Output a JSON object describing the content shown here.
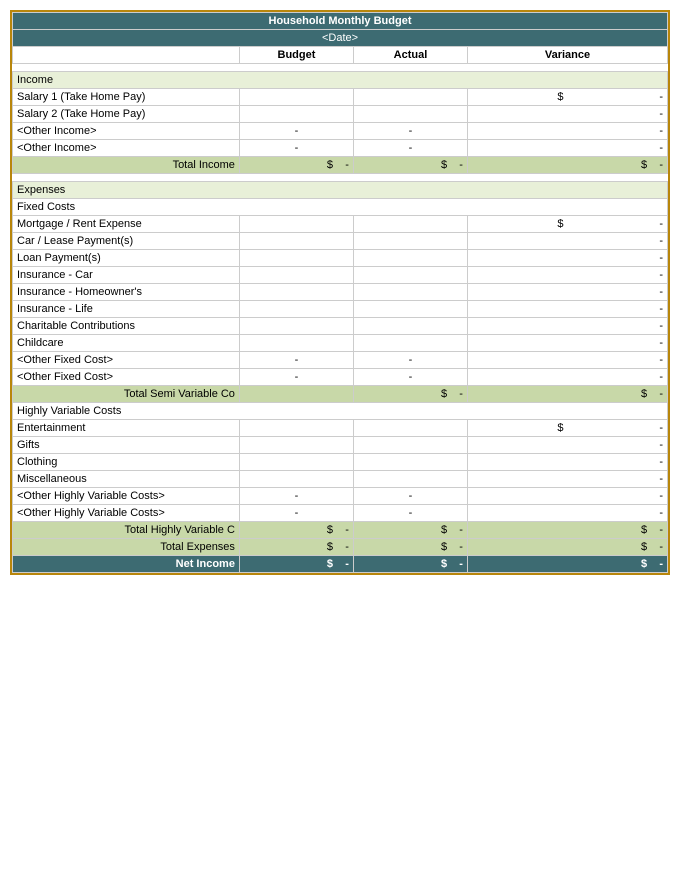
{
  "header": {
    "title": "Household Monthly Budget",
    "date": "<Date>",
    "col_budget": "Budget",
    "col_actual": "Actual",
    "col_variance": "Variance"
  },
  "income": {
    "section_label": "Income",
    "rows": [
      {
        "label": "Salary 1 (Take Home Pay)",
        "budget": "",
        "actual": "",
        "variance_dollar": "$",
        "variance": "-"
      },
      {
        "label": "Salary 2 (Take Home Pay)",
        "budget": "",
        "actual": "",
        "variance_dollar": "",
        "variance": "-"
      },
      {
        "label": "<Other Income>",
        "budget": "-",
        "actual": "-",
        "variance_dollar": "",
        "variance": "-"
      },
      {
        "label": "<Other Income>",
        "budget": "-",
        "actual": "-",
        "variance_dollar": "",
        "variance": "-"
      }
    ],
    "total_label": "Total Income",
    "total_budget_dollar": "$",
    "total_budget": "-",
    "total_actual_dollar": "$",
    "total_actual": "-",
    "total_variance_dollar": "$",
    "total_variance": "-"
  },
  "expenses": {
    "section_label": "Expenses",
    "fixed_costs_label": "Fixed Costs",
    "fixed_rows": [
      {
        "label": "Mortgage / Rent Expense",
        "budget": "",
        "actual": "",
        "variance_dollar": "$",
        "variance": "-"
      },
      {
        "label": "Car / Lease Payment(s)",
        "budget": "",
        "actual": "",
        "variance_dollar": "",
        "variance": "-"
      },
      {
        "label": "Loan Payment(s)",
        "budget": "",
        "actual": "",
        "variance_dollar": "",
        "variance": "-"
      },
      {
        "label": "Insurance - Car",
        "budget": "",
        "actual": "",
        "variance_dollar": "",
        "variance": "-"
      },
      {
        "label": "Insurance - Homeowner's",
        "budget": "",
        "actual": "",
        "variance_dollar": "",
        "variance": "-"
      },
      {
        "label": "Insurance - Life",
        "budget": "",
        "actual": "",
        "variance_dollar": "",
        "variance": "-"
      },
      {
        "label": "Charitable Contributions",
        "budget": "",
        "actual": "",
        "variance_dollar": "",
        "variance": "-"
      },
      {
        "label": "Childcare",
        "budget": "",
        "actual": "",
        "variance_dollar": "",
        "variance": "-"
      },
      {
        "label": "<Other Fixed Cost>",
        "budget": "-",
        "actual": "-",
        "variance_dollar": "",
        "variance": "-"
      },
      {
        "label": "<Other Fixed Cost>",
        "budget": "-",
        "actual": "-",
        "variance_dollar": "",
        "variance": "-"
      }
    ],
    "fixed_total_label": "Total Semi Variable Co",
    "fixed_total_budget_dollar": "",
    "fixed_total_budget": "",
    "fixed_total_actual_dollar": "$",
    "fixed_total_actual": "-",
    "fixed_total_variance_dollar": "$",
    "fixed_total_variance": "-",
    "variable_costs_label": "Highly Variable Costs",
    "variable_rows": [
      {
        "label": "Entertainment",
        "budget": "",
        "actual": "",
        "variance_dollar": "$",
        "variance": "-"
      },
      {
        "label": "Gifts",
        "budget": "",
        "actual": "",
        "variance_dollar": "",
        "variance": "-"
      },
      {
        "label": "Clothing",
        "budget": "",
        "actual": "",
        "variance_dollar": "",
        "variance": "-"
      },
      {
        "label": "Miscellaneous",
        "budget": "",
        "actual": "",
        "variance_dollar": "",
        "variance": "-"
      },
      {
        "label": "<Other Highly Variable Costs>",
        "budget": "-",
        "actual": "-",
        "variance_dollar": "",
        "variance": "-"
      },
      {
        "label": "<Other Highly Variable Costs>",
        "budget": "-",
        "actual": "-",
        "variance_dollar": "",
        "variance": "-"
      }
    ],
    "variable_total_label": "Total Highly Variable C",
    "variable_total_budget_dollar": "$",
    "variable_total_budget": "-",
    "variable_total_actual_dollar": "$",
    "variable_total_actual": "-",
    "variable_total_variance_dollar": "$",
    "variable_total_variance": "-",
    "total_expenses_label": "Total Expenses",
    "total_expenses_budget_dollar": "$",
    "total_expenses_budget": "-",
    "total_expenses_actual_dollar": "$",
    "total_expenses_actual": "-",
    "total_expenses_variance_dollar": "$",
    "total_expenses_variance": "-"
  },
  "net_income": {
    "label": "Net Income",
    "budget_dollar": "$",
    "budget": "-",
    "actual_dollar": "$",
    "actual": "-",
    "variance_dollar": "$",
    "variance": "-"
  }
}
